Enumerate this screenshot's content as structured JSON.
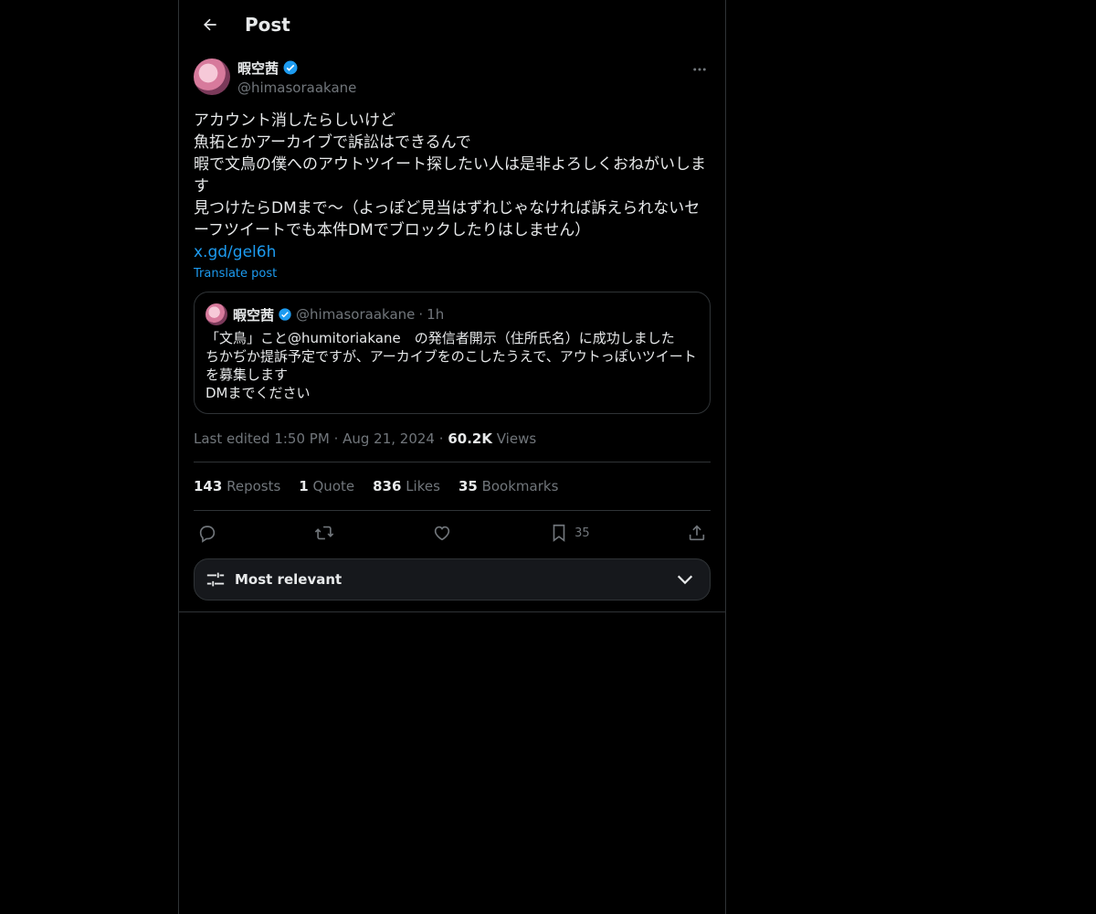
{
  "header": {
    "title": "Post"
  },
  "author": {
    "name": "暇空茜",
    "handle": "@himasoraakane"
  },
  "post": {
    "text": "アカウント消したらしいけど\n魚拓とかアーカイブで訴訟はできるんで\n暇で文鳥の僕へのアウトツイート探したい人は是非よろしくおねがいします\n見つけたらDMまで〜（よっぽど見当はずれじゃなければ訴えられないセーフツイートでも本件DMでブロックしたりはしません）",
    "link": "x.gd/gel6h",
    "translate": "Translate post"
  },
  "quote": {
    "name": "暇空茜",
    "handle": "@himasoraakane",
    "dot": "·",
    "time": "1h",
    "text": "「文鳥」こと@humitoriakane　の発信者開示（住所氏名）に成功しました\nちかぢか提訴予定ですが、アーカイブをのこしたうえで、アウトっぽいツイートを募集します\nDMまでください"
  },
  "meta": {
    "edited": "Last edited 1:50 PM",
    "dot1": "·",
    "date": "Aug 21, 2024",
    "dot2": "·",
    "views_count": "60.2K",
    "views_label": "Views"
  },
  "stats": {
    "reposts_count": "143",
    "reposts_label": "Reposts",
    "quotes_count": "1",
    "quotes_label": "Quote",
    "likes_count": "836",
    "likes_label": "Likes",
    "bookmarks_count": "35",
    "bookmarks_label": "Bookmarks"
  },
  "actions": {
    "bookmark_count": "35"
  },
  "sort": {
    "label": "Most relevant"
  },
  "colors": {
    "accent": "#1d9bf0",
    "muted": "#71767b",
    "border": "#2f3336",
    "background": "#000000"
  }
}
